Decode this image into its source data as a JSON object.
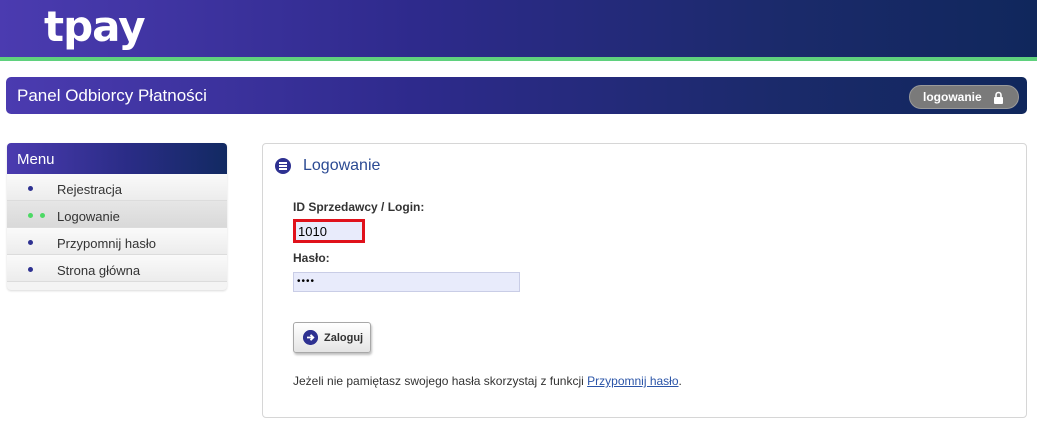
{
  "header": {
    "logo_text": "tpay"
  },
  "titlebar": {
    "title": "Panel Odbiorcy Płatności",
    "login_badge": "logowanie"
  },
  "menu": {
    "heading": "Menu",
    "items": [
      {
        "label": "Rejestracja",
        "active": false
      },
      {
        "label": "Logowanie",
        "active": true
      },
      {
        "label": "Przypomnij hasło",
        "active": false
      },
      {
        "label": "Strona główna",
        "active": false
      }
    ]
  },
  "login_panel": {
    "title": "Logowanie",
    "login_label": "ID Sprzedawcy / Login:",
    "login_value": "1010",
    "password_label": "Hasło:",
    "password_value": "••••",
    "submit_label": "Zaloguj",
    "hint_text": "Jeżeli nie pamiętasz swojego hasła skorzystaj z funkcji ",
    "hint_link": "Przypomnij hasło",
    "hint_end": "."
  },
  "colors": {
    "brand": "#2e3191",
    "accent_green": "#5fd17d",
    "highlight": "#e0111b"
  }
}
